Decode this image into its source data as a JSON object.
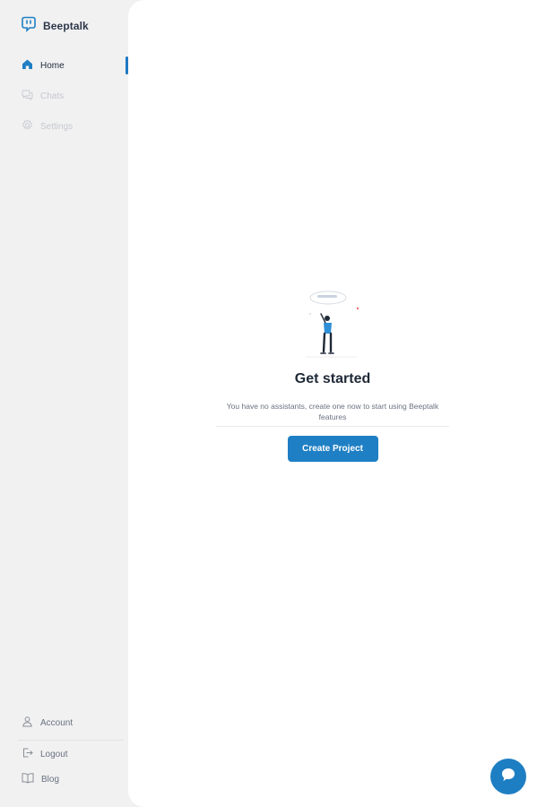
{
  "brand": {
    "name": "Beeptalk",
    "icon": "beeptalk-logo-icon"
  },
  "sidebar": {
    "items": [
      {
        "label": "Home",
        "icon": "home-icon",
        "state": "active"
      },
      {
        "label": "Chats",
        "icon": "chat-bubbles-icon",
        "state": "disabled"
      },
      {
        "label": "Settings",
        "icon": "gear-icon",
        "state": "disabled"
      }
    ],
    "bottom_items": [
      {
        "label": "Account",
        "icon": "user-icon"
      },
      {
        "label": "Logout",
        "icon": "logout-icon"
      },
      {
        "label": "Blog",
        "icon": "book-icon"
      }
    ]
  },
  "main": {
    "heading": "Get started",
    "description": "You have no assistants, create one now to start using Beeptalk features",
    "cta_label": "Create Project"
  },
  "fab": {
    "icon": "chat-icon"
  },
  "colors": {
    "accent": "#1f7fc4",
    "sidebar_bg": "#f1f1f2",
    "panel_bg": "#ffffff",
    "text_dark": "#1f2937",
    "text_muted": "#c5c8cc"
  }
}
